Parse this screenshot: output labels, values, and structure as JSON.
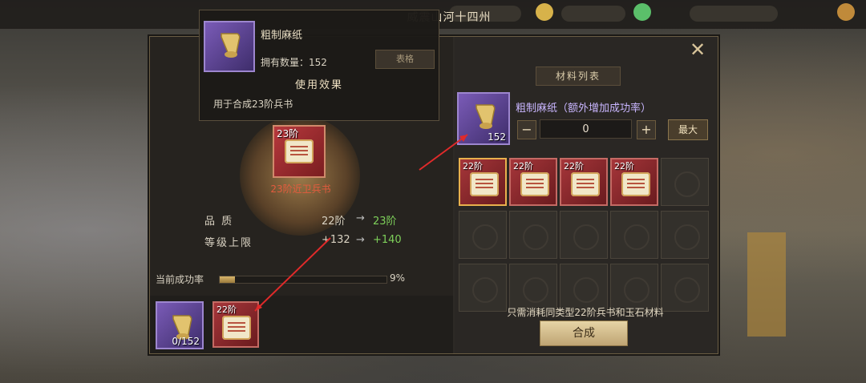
{
  "panel": {
    "title": "威震山河十四州",
    "material_list_label": "材料列表",
    "close_icon": "close-icon"
  },
  "material": {
    "name": "粗制麻纸（额外增加成功率）",
    "count": "152",
    "stepper_value": "0",
    "minus_label": "−",
    "plus_label": "+",
    "max_label": "最大",
    "icon": "paper-scroll-icon"
  },
  "grid": {
    "cells": [
      {
        "tier": "22阶",
        "filled": true,
        "selected": true
      },
      {
        "tier": "22阶",
        "filled": true,
        "selected": false
      },
      {
        "tier": "22阶",
        "filled": true,
        "selected": false
      },
      {
        "tier": "22阶",
        "filled": true,
        "selected": false
      },
      {
        "tier": "",
        "filled": false,
        "selected": false
      },
      {
        "tier": "",
        "filled": false,
        "selected": false
      },
      {
        "tier": "",
        "filled": false,
        "selected": false
      },
      {
        "tier": "",
        "filled": false,
        "selected": false
      },
      {
        "tier": "",
        "filled": false,
        "selected": false
      },
      {
        "tier": "",
        "filled": false,
        "selected": false
      },
      {
        "tier": "",
        "filled": false,
        "selected": false
      },
      {
        "tier": "",
        "filled": false,
        "selected": false
      },
      {
        "tier": "",
        "filled": false,
        "selected": false
      },
      {
        "tier": "",
        "filled": false,
        "selected": false
      },
      {
        "tier": "",
        "filled": false,
        "selected": false
      }
    ]
  },
  "note": "只需消耗同类型22阶兵书和玉石材料",
  "craft_label": "合成",
  "result_book": {
    "tier": "23阶",
    "name": "23阶近卫兵书"
  },
  "stats": [
    {
      "label": "品 质",
      "from": "22阶",
      "arrow": "→",
      "to": "23阶"
    },
    {
      "label": "等级上限",
      "from": "+132",
      "arrow": "→",
      "to": "+140"
    }
  ],
  "success_rate": {
    "label": "当前成功率",
    "value": "9%",
    "fraction": 0.09
  },
  "bottom_slots": {
    "paper_count": "0/152",
    "book_tier": "22阶"
  },
  "tooltip": {
    "name": "粗制麻纸",
    "owned": "拥有数量：152",
    "section": "使用效果",
    "effect": "用于合成23阶兵书",
    "tab": "表格"
  }
}
